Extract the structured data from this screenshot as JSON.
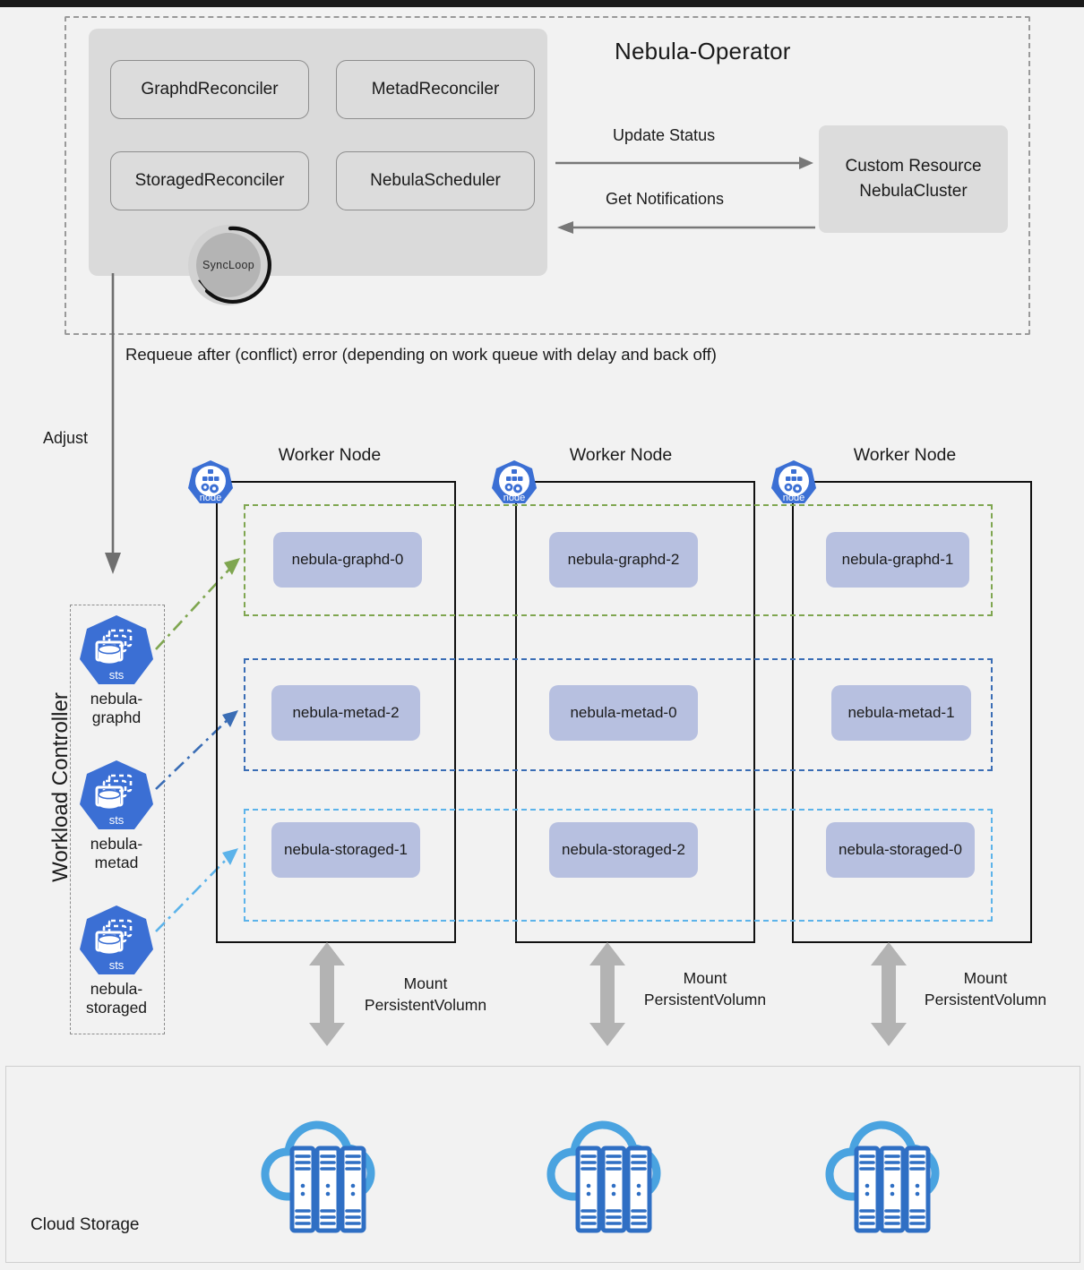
{
  "page": {
    "background": "#f2f2f2",
    "accent_blue": "#3b6fd4",
    "pod_fill": "#b7c0e0",
    "band_graphd_color": "#7fa650",
    "band_metad_color": "#3a6db5",
    "band_storaged_color": "#5cb3ea",
    "cloud_icon_color": "#4aa3e0",
    "server_icon_color": "#2f6fc4"
  },
  "operator": {
    "title": "Nebula-Operator",
    "reconcilers": [
      {
        "label": "GraphdReconciler"
      },
      {
        "label": "MetadReconciler"
      },
      {
        "label": "StoragedReconciler"
      },
      {
        "label": "NebulaScheduler"
      }
    ],
    "sync_loop_label": "SyncLoop",
    "custom_resource": {
      "line1": "Custom Resource",
      "line2": "NebulaCluster"
    },
    "arrows": {
      "update_status": "Update Status",
      "get_notifications": "Get Notifications"
    }
  },
  "flow_labels": {
    "requeue": "Requeue after (conflict) error (depending on work queue with delay and back off)",
    "adjust": "Adjust"
  },
  "workload_controller": {
    "title": "Workload Controller",
    "statefulsets": [
      {
        "icon": "statefulset-icon",
        "badge": "sts",
        "line1": "nebula-",
        "line2": "graphd"
      },
      {
        "icon": "statefulset-icon",
        "badge": "sts",
        "line1": "nebula-",
        "line2": "metad"
      },
      {
        "icon": "statefulset-icon",
        "badge": "sts",
        "line1": "nebula-",
        "line2": "storaged"
      }
    ]
  },
  "worker_nodes": [
    {
      "title": "Worker Node",
      "node_badge": "node",
      "pods": [
        "nebula-graphd-0",
        "nebula-metad-2",
        "nebula-storaged-1"
      ],
      "mount_label_line1": "Mount",
      "mount_label_line2": "PersistentVolumn"
    },
    {
      "title": "Worker Node",
      "node_badge": "node",
      "pods": [
        "nebula-graphd-2",
        "nebula-metad-0",
        "nebula-storaged-2"
      ],
      "mount_label_line1": "Mount",
      "mount_label_line2": "PersistentVolumn"
    },
    {
      "title": "Worker Node",
      "node_badge": "node",
      "pods": [
        "nebula-graphd-1",
        "nebula-metad-1",
        "nebula-storaged-0"
      ],
      "mount_label_line1": "Mount",
      "mount_label_line2": "PersistentVolumn"
    }
  ],
  "cloud_storage": {
    "label": "Cloud Storage",
    "icons": [
      "cloud-server-icon",
      "cloud-server-icon",
      "cloud-server-icon"
    ]
  }
}
